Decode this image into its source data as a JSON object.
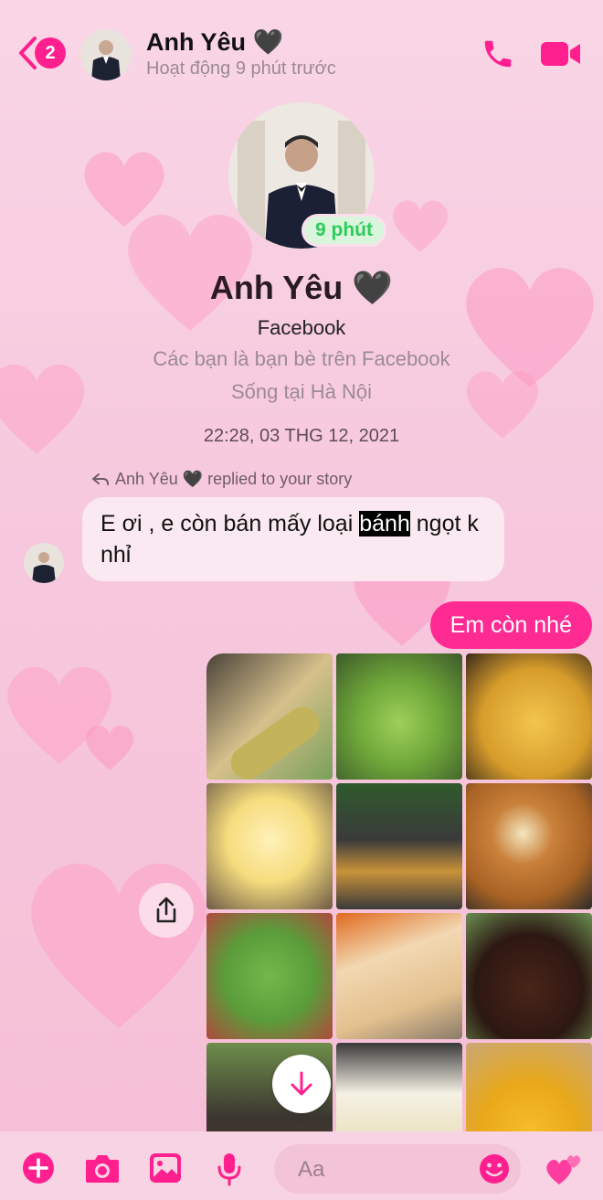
{
  "colors": {
    "accent": "#ff1f8e",
    "bubble_out": "#ff2b92",
    "active_green": "#2ecc5a"
  },
  "header": {
    "back_badge": "2",
    "name": "Anh Yêu 🖤",
    "status": "Hoạt động 9 phút trước",
    "icons": [
      "back-chevron-icon",
      "phone-icon",
      "video-camera-icon"
    ]
  },
  "profile": {
    "active_pill": "9 phút",
    "name": "Anh Yêu 🖤",
    "platform": "Facebook",
    "friends_line": "Các bạn là bạn bè trên Facebook",
    "location": "Sống tại Hà Nội"
  },
  "thread": {
    "timestamp": "22:28, 03 THG 12, 2021",
    "reply_note": "Anh Yêu 🖤 replied to your story",
    "incoming": {
      "before": "E ơi , e còn bán mấy loại ",
      "highlight": "bánh",
      "after": " ngọt k nhỉ"
    },
    "outgoing": "Em còn nhé",
    "photo_count": 12
  },
  "composer": {
    "placeholder": "Aa",
    "icons": [
      "plus-icon",
      "camera-icon",
      "image-icon",
      "microphone-icon",
      "emoji-icon",
      "hearts-icon"
    ]
  }
}
